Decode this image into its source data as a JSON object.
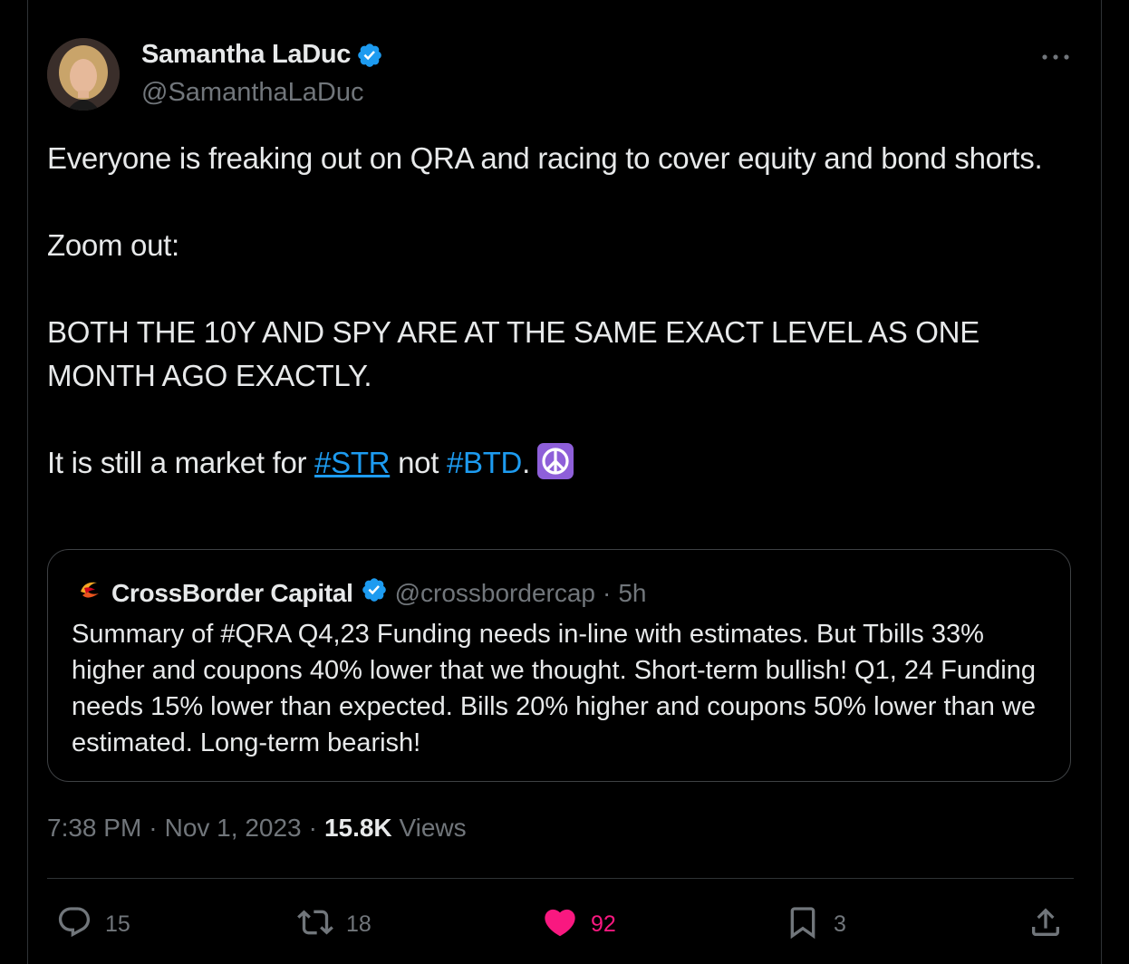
{
  "author": {
    "name": "Samantha LaDuc",
    "handle": "@SamanthaLaDuc",
    "verified": true
  },
  "more_icon": "ellipsis-icon",
  "tweet": {
    "line1": "Everyone is freaking out on QRA and racing to cover equity and bond shorts.",
    "line2": "Zoom out:",
    "line3": "BOTH THE 10Y AND SPY ARE AT THE SAME EXACT LEVEL AS ONE MONTH AGO EXACTLY.",
    "line4_prefix": "It is still a market for ",
    "hashtag1": "#STR",
    "line4_mid": " not ",
    "hashtag2": "#BTD",
    "line4_suffix": ".",
    "emoji": "peace-symbol"
  },
  "quote": {
    "name": "CrossBorder Capital",
    "handle": "@crossbordercap",
    "separator": "·",
    "time": "5h",
    "text": "Summary of #QRA Q4,23 Funding needs in-line with estimates. But Tbills 33% higher and coupons 40% lower that we thought. Short-term bullish! Q1, 24 Funding needs 15% lower than expected. Bills 20% higher and coupons 50% lower than we estimated. Long-term bearish!"
  },
  "meta": {
    "time": "7:38 PM",
    "sep1": "·",
    "date": "Nov 1, 2023",
    "sep2": "·",
    "views_count": "15.8K",
    "views_label": "Views"
  },
  "actions": {
    "replies": "15",
    "reposts": "18",
    "likes": "92",
    "bookmarks": "3"
  },
  "colors": {
    "background": "#000000",
    "text": "#e7e9ea",
    "secondary": "#71767b",
    "link": "#1d9bf0",
    "like": "#f91880",
    "verified": "#1d9bf0"
  }
}
